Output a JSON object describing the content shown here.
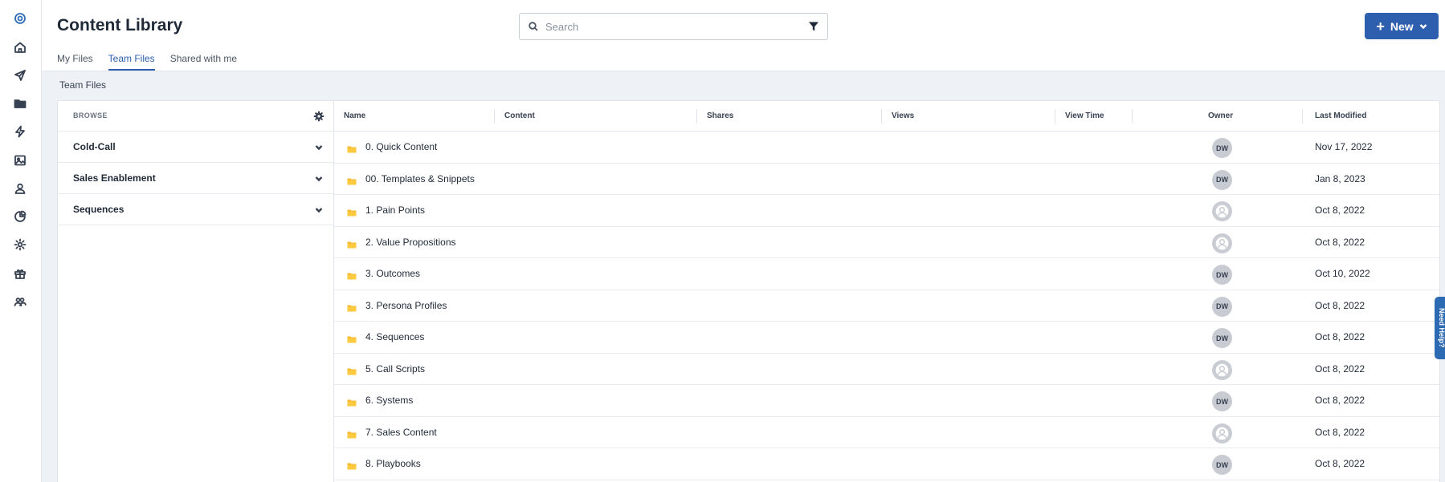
{
  "app": {
    "title": "Content Library",
    "accent_color": "#2d5fae"
  },
  "rail": {
    "icons": [
      "logo-icon",
      "home-icon",
      "send-icon",
      "folder-icon",
      "lightning-icon",
      "image-icon",
      "person-icon",
      "analytics-icon",
      "gear-icon",
      "gift-icon",
      "team-icon"
    ],
    "active": "folder-icon"
  },
  "search": {
    "placeholder": "Search",
    "value": ""
  },
  "toolbar": {
    "new_label": "New"
  },
  "tabs": [
    {
      "label": "My Files",
      "active": false
    },
    {
      "label": "Team Files",
      "active": true
    },
    {
      "label": "Shared with me",
      "active": false
    }
  ],
  "section_title": "Team Files",
  "browse": {
    "label": "BROWSE",
    "items": [
      {
        "label": "Cold-Call"
      },
      {
        "label": "Sales Enablement"
      },
      {
        "label": "Sequences"
      }
    ]
  },
  "table": {
    "columns": [
      "Name",
      "Content",
      "Shares",
      "Views",
      "View Time",
      "Owner",
      "Last Modified"
    ],
    "rows": [
      {
        "name": "0. Quick Content",
        "owner": "DW",
        "modified": "Nov 17, 2022"
      },
      {
        "name": "00. Templates & Snippets",
        "owner": "DW",
        "modified": "Jan 8, 2023"
      },
      {
        "name": "1. Pain Points",
        "owner": "",
        "modified": "Oct 8, 2022"
      },
      {
        "name": "2. Value Propositions",
        "owner": "",
        "modified": "Oct 8, 2022"
      },
      {
        "name": "3. Outcomes",
        "owner": "DW",
        "modified": "Oct 10, 2022"
      },
      {
        "name": "3. Persona Profiles",
        "owner": "DW",
        "modified": "Oct 8, 2022"
      },
      {
        "name": "4. Sequences",
        "owner": "DW",
        "modified": "Oct 8, 2022"
      },
      {
        "name": "5. Call Scripts",
        "owner": "",
        "modified": "Oct 8, 2022"
      },
      {
        "name": "6. Systems",
        "owner": "DW",
        "modified": "Oct 8, 2022"
      },
      {
        "name": "7. Sales Content",
        "owner": "",
        "modified": "Oct 8, 2022"
      },
      {
        "name": "8. Playbooks",
        "owner": "DW",
        "modified": "Oct 8, 2022"
      }
    ]
  },
  "help_tab": {
    "label": "Need Help?"
  }
}
